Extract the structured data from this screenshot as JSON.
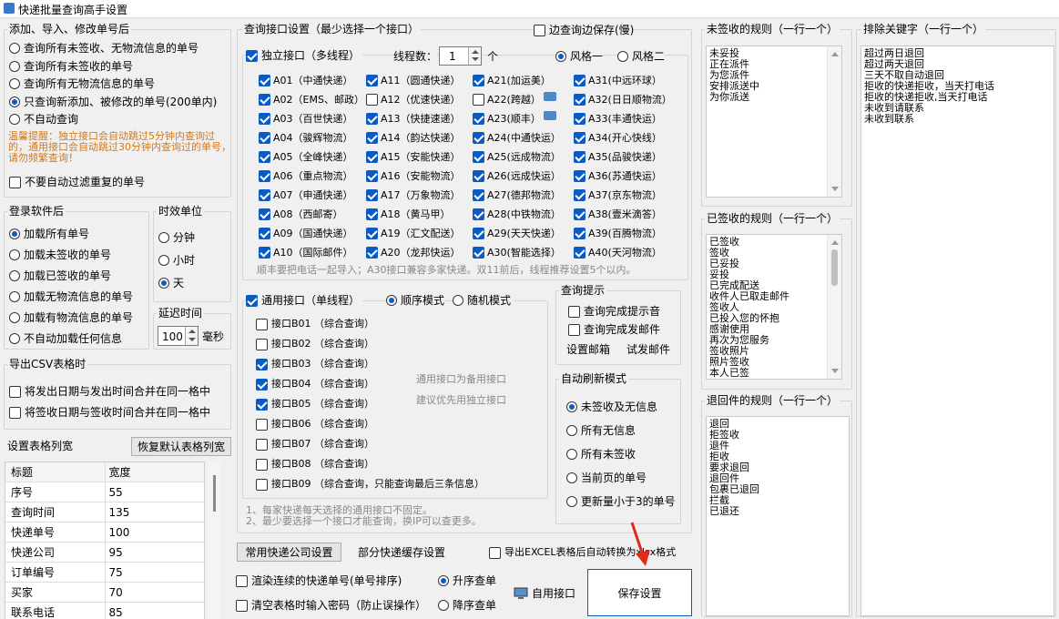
{
  "window": {
    "title": "快递批量查询高手设置"
  },
  "left": {
    "add_group": {
      "title": "添加、导入、修改单号后",
      "options": [
        "查询所有未签收、无物流信息的单号",
        "查询所有未签收的单号",
        "查询所有无物流信息的单号",
        "只查询新添加、被修改的单号(200单内)",
        "不自动查询"
      ],
      "selected": 3,
      "warning": "温馨提醒：独立接口会自动跳过5分钟内查询过的，通用接口会自动跳过30分钟内查询过的单号，请勿频繁查询！",
      "no_filter_label": "不要自动过滤重复的单号"
    },
    "login_group": {
      "title": "登录软件后",
      "options": [
        "加载所有单号",
        "加载未签收的单号",
        "加载已签收的单号",
        "加载无物流信息的单号",
        "加载有物流信息的单号",
        "不自动加载任何信息"
      ],
      "selected": 0
    },
    "time_unit": {
      "title": "时效单位",
      "options": [
        "分钟",
        "小时",
        "天"
      ],
      "selected": 2
    },
    "delay": {
      "title": "延迟时间",
      "value": "100",
      "unit": "毫秒"
    },
    "csv_group": {
      "title": "导出CSV表格时",
      "options": [
        "将发出日期与发出时间合并在同一格中",
        "将签收日期与签收时间合并在同一格中"
      ]
    },
    "columns": {
      "title": "设置表格列宽",
      "reset_button": "恢复默认表格列宽",
      "header": [
        "标题",
        "宽度"
      ],
      "rows": [
        [
          "序号",
          "55"
        ],
        [
          "查询时间",
          "135"
        ],
        [
          "快递单号",
          "100"
        ],
        [
          "快递公司",
          "95"
        ],
        [
          "订单编号",
          "75"
        ],
        [
          "买家",
          "70"
        ],
        [
          "联系电话",
          "85"
        ]
      ]
    }
  },
  "middle": {
    "title": "查询接口设置（最少选择一个接口）",
    "save_while_query": "边查询边保存(慢)",
    "independent": {
      "label": "独立接口（多线程）",
      "threads_label": "线程数：",
      "threads_value": "1",
      "threads_unit": "个",
      "style_options": [
        "风格一",
        "风格二"
      ],
      "items": [
        {
          "label": "A01（中通快递）",
          "on": true
        },
        {
          "label": "A11（圆通快递）",
          "on": true
        },
        {
          "label": "A21(加运美）",
          "on": true
        },
        {
          "label": "A31(中远环球）",
          "on": true
        },
        {
          "label": "A02（EMS、邮政）",
          "on": true
        },
        {
          "label": "A12（优速快递）",
          "on": false
        },
        {
          "label": "A22(跨越）",
          "on": false
        },
        {
          "label": "A32(日日顺物流）",
          "on": true
        },
        {
          "label": "A03（百世快递）",
          "on": true
        },
        {
          "label": "A13（快捷速递）",
          "on": true
        },
        {
          "label": "A23(顺丰）",
          "on": true
        },
        {
          "label": "A33(丰通快运）",
          "on": true
        },
        {
          "label": "A04（骏辉物流）",
          "on": true
        },
        {
          "label": "A14（韵达快递）",
          "on": true
        },
        {
          "label": "A24(中通快运）",
          "on": true
        },
        {
          "label": "A34(开心快线）",
          "on": true
        },
        {
          "label": "A05（全峰快递）",
          "on": true
        },
        {
          "label": "A15（安能快递）",
          "on": true
        },
        {
          "label": "A25(远成物流）",
          "on": true
        },
        {
          "label": "A35(品骏快递）",
          "on": true
        },
        {
          "label": "A06（重点物流）",
          "on": true
        },
        {
          "label": "A16（安能物流）",
          "on": true
        },
        {
          "label": "A26(远成快运）",
          "on": true
        },
        {
          "label": "A36(苏通快运）",
          "on": true
        },
        {
          "label": "A07（申通快递）",
          "on": true
        },
        {
          "label": "A17（万象物流）",
          "on": true
        },
        {
          "label": "A27(德邦物流）",
          "on": true
        },
        {
          "label": "A37(京东物流）",
          "on": true
        },
        {
          "label": "A08（西邮寄）",
          "on": true
        },
        {
          "label": "A18（黄马甲）",
          "on": true
        },
        {
          "label": "A28(中铁物流）",
          "on": true
        },
        {
          "label": "A38(壹米滴答）",
          "on": true
        },
        {
          "label": "A09（国通快递）",
          "on": true
        },
        {
          "label": "A19（汇文配送）",
          "on": true
        },
        {
          "label": "A29(天天快递）",
          "on": true
        },
        {
          "label": "A39(百腾物流）",
          "on": true
        },
        {
          "label": "A10（国际邮件）",
          "on": true
        },
        {
          "label": "A20（龙邦快运）",
          "on": true
        },
        {
          "label": "A30(智能选择）",
          "on": true
        },
        {
          "label": "A40(天河物流）",
          "on": true
        }
      ],
      "note": "顺丰要把电话一起导入；A30接口兼容多家快递。双11前后，线程推荐设置5个以内。"
    },
    "general": {
      "label": "通用接口（单线程）",
      "modes": [
        "顺序模式",
        "随机模式"
      ],
      "items": [
        {
          "label": "接口B01 （综合查询）",
          "on": false
        },
        {
          "label": "接口B02 （综合查询）",
          "on": false
        },
        {
          "label": "接口B03 （综合查询）",
          "on": true
        },
        {
          "label": "接口B04 （综合查询）",
          "on": true
        },
        {
          "label": "接口B05 （综合查询）",
          "on": true
        },
        {
          "label": "接口B06 （综合查询）",
          "on": false
        },
        {
          "label": "接口B07 （综合查询）",
          "on": false
        },
        {
          "label": "接口B08 （综合查询）",
          "on": false
        },
        {
          "label": "接口B09 （综合查询，只能查询最后三条信息）",
          "on": false
        }
      ],
      "backup_hint_1": "通用接口为备用接口",
      "backup_hint_2": "建议优先用独立接口"
    },
    "notes": [
      "1、每家快递每天选择的通用接口不固定。",
      "2、最少要选择一个接口才能查询，换IP可以查更多。"
    ],
    "query_tips": {
      "title": "查询提示",
      "options": [
        "查询完成提示音",
        "查询完成发邮件"
      ],
      "set_mail": "设置邮箱",
      "test_mail": "试发邮件"
    },
    "auto_refresh": {
      "title": "自动刷新模式",
      "options": [
        "未签收及无信息",
        "所有无信息",
        "所有未签收",
        "当前页的单号",
        "更新量小于3的单号"
      ],
      "selected": 0
    }
  },
  "bottom": {
    "common_button": "常用快递公司设置",
    "cache_settings": "部分快递缓存设置",
    "export_excel": "导出EXCEL表格后自动转换为xlsx格式",
    "render_serial": "渲染连续的快递单号(单号排序)",
    "clear_pwd": "清空表格时输入密码（防止误操作）",
    "sort_options": [
      "升序查单",
      "降序查单"
    ],
    "self_interface": "自用接口",
    "save_button": "保存设置"
  },
  "rules": {
    "unsigned": {
      "title": "未签收的规则（一行一个）",
      "lines": [
        "未妥投",
        "正在派件",
        "为您派件",
        "安排派送中",
        "为你派送"
      ]
    },
    "signed": {
      "title": "已签收的规则（一行一个）",
      "lines": [
        "已签收",
        "签收",
        "已妥投",
        "妥投",
        "已完成配送",
        "收件人已取走邮件",
        "签收人",
        "已投入您的怀抱",
        "感谢使用",
        "再次为您服务",
        "签收照片",
        "照片签收",
        "本人已签"
      ]
    },
    "returned": {
      "title": "退回件的规则（一行一个）",
      "lines": [
        "退回",
        "拒签收",
        "退件",
        "拒收",
        "要求退回",
        "退回件",
        "包裹已退回",
        "拦截",
        "已退还"
      ]
    },
    "exclude": {
      "title": "排除关键字（一行一个）",
      "lines": [
        "超过两日退回",
        "超过两天退回",
        "三天不取自动退回",
        "拒收的快递拒收，当天打电话",
        "拒收的快递拒收,当天打电话",
        "未收到请联系",
        "未收到联系"
      ]
    }
  }
}
